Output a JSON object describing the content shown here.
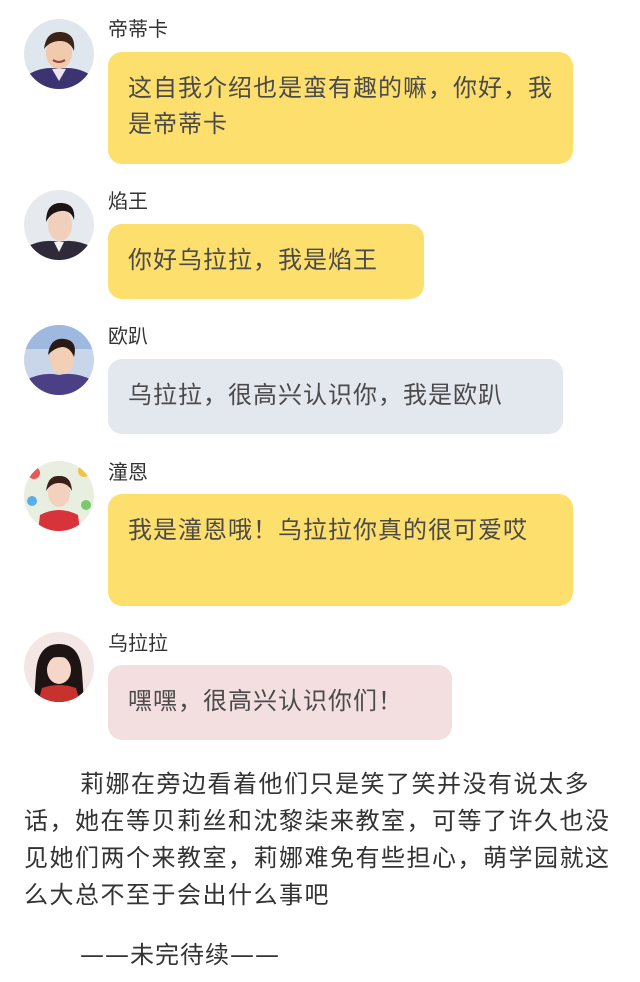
{
  "messages": [
    {
      "speaker": "帝蒂卡",
      "text": "这自我介绍也是蛮有趣的嘛，你好，我是帝蒂卡",
      "bubble_color": "#fddf6e",
      "avatar": "avatar-ditika"
    },
    {
      "speaker": "焰王",
      "text": "你好乌拉拉，我是焰王",
      "bubble_color": "#fddf6e",
      "avatar": "avatar-yanwang"
    },
    {
      "speaker": "欧趴",
      "text": "乌拉拉，很高兴认识你，我是欧趴",
      "bubble_color": "#e3e7ee",
      "avatar": "avatar-oupa"
    },
    {
      "speaker": "潼恩",
      "text": "我是潼恩哦！乌拉拉你真的很可爱哎",
      "bubble_color": "#fddf6e",
      "avatar": "avatar-tongen"
    },
    {
      "speaker": "乌拉拉",
      "text": "嘿嘿，很高兴认识你们！",
      "bubble_color": "#f4dfe0",
      "avatar": "avatar-wulala"
    }
  ],
  "narration": "莉娜在旁边看着他们只是笑了笑并没有说太多话，她在等贝莉丝和沈黎柒来教室，可等了许久也没见她们两个来教室，莉娜难免有些担心，萌学园就这么大总不至于会出什么事吧",
  "ending": "——未完待续——"
}
